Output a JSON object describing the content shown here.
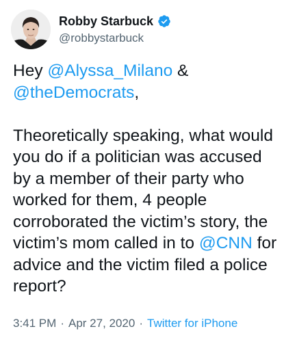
{
  "author": {
    "display_name": "Robby Starbuck",
    "handle": "@robbystarbuck",
    "verified": true,
    "avatar_icon": "profile-photo-icon",
    "verified_icon": "verified-badge-icon"
  },
  "tweet": {
    "line1": {
      "prefix": "Hey ",
      "mention1": "@Alyssa_Milano",
      "suffix": " &"
    },
    "line2": {
      "mention": "@theDemocrats",
      "suffix": ","
    },
    "lines_mid": [
      "Theoretically speaking, what would",
      "you do if a politician was accused",
      "by a member of their party who",
      "worked for them, 4 people",
      "corroborated the victim’s story, the"
    ],
    "line8": {
      "prefix": "victim’s mom called in to ",
      "mention": "@CNN",
      "suffix": " for"
    },
    "lines_end": [
      "advice and the victim filed a police",
      "report?"
    ]
  },
  "meta": {
    "time": "3:41 PM",
    "separator": "·",
    "date": "Apr 27, 2020",
    "source": "Twitter for iPhone"
  },
  "colors": {
    "text": "#0f1419",
    "secondary": "#536471",
    "link": "#1d9bf0",
    "background": "#ffffff"
  }
}
